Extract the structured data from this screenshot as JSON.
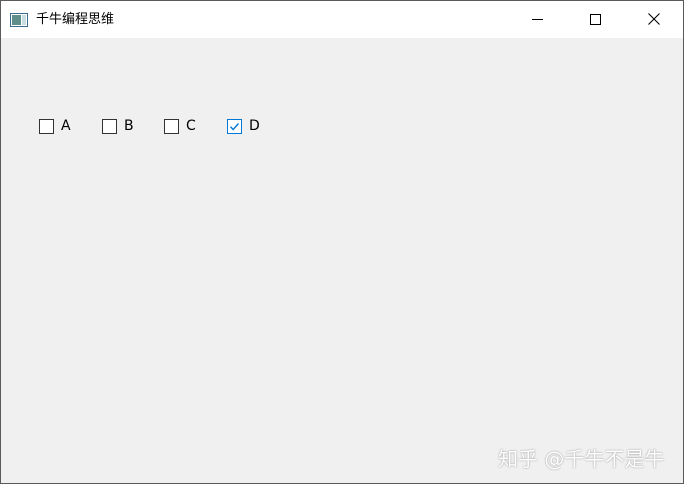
{
  "window": {
    "title": "千牛编程思维",
    "app_icon": "window-app-icon",
    "controls": {
      "minimize_icon": "minimize-icon",
      "maximize_icon": "maximize-icon",
      "close_icon": "close-icon"
    }
  },
  "checkboxes": [
    {
      "label": "A",
      "checked": false
    },
    {
      "label": "B",
      "checked": false
    },
    {
      "label": "C",
      "checked": false
    },
    {
      "label": "D",
      "checked": true
    }
  ],
  "watermark": "知乎 @千牛不是牛",
  "colors": {
    "client_background": "#f0f0f0",
    "titlebar_background": "#ffffff",
    "check_accent": "#0078d7"
  }
}
